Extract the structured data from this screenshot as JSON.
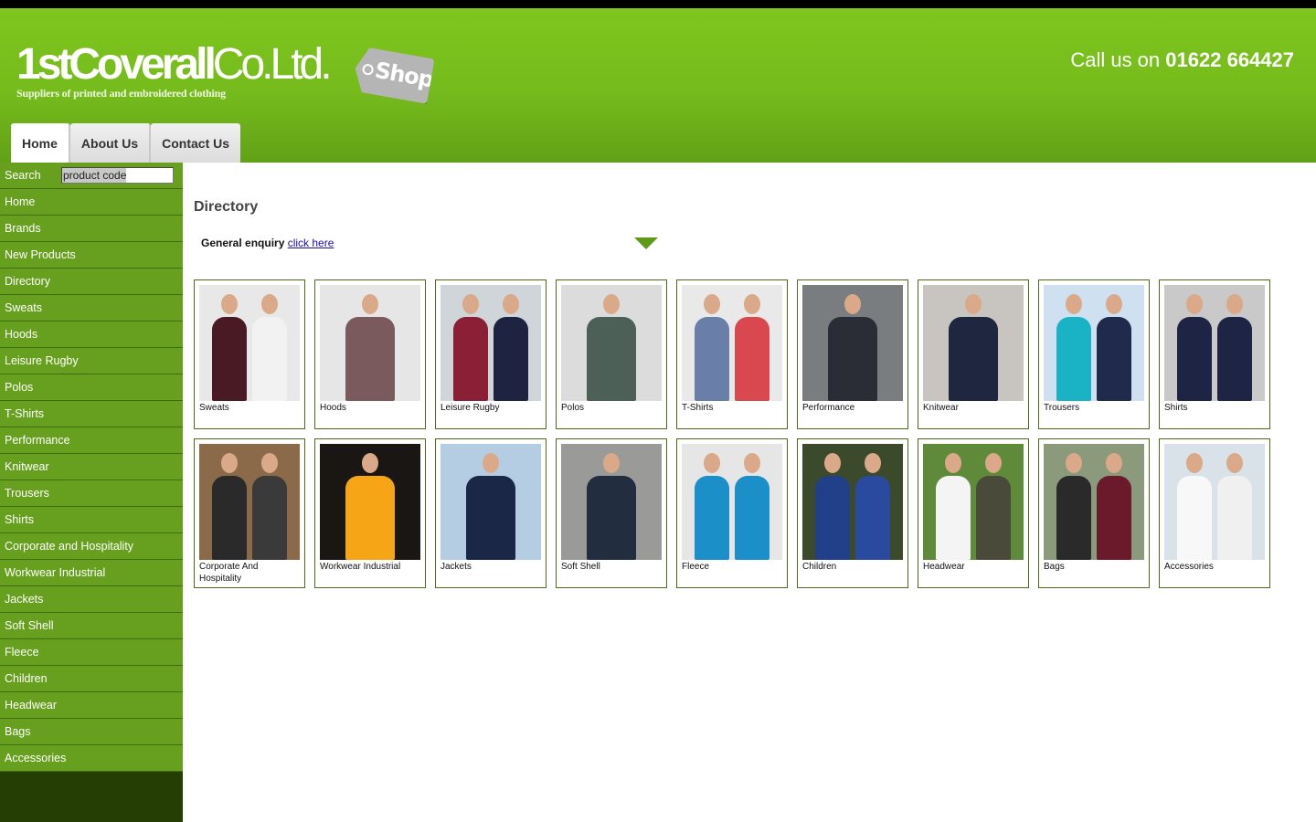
{
  "header": {
    "logo_bold": "1stCoverall",
    "logo_light": "Co.Ltd.",
    "logo_tag": "Shop",
    "tagline": "Suppliers of printed and embroidered clothing",
    "call_prefix": "Call us on",
    "phone": "01622 664427"
  },
  "tabs": [
    {
      "label": "Home",
      "active": true
    },
    {
      "label": "About Us",
      "active": false
    },
    {
      "label": "Contact Us",
      "active": false
    }
  ],
  "sidebar": {
    "search_label": "Search",
    "search_value": "product code",
    "items": [
      "Home",
      "Brands",
      "New Products",
      "Directory",
      "Sweats",
      "Hoods",
      "Leisure Rugby",
      "Polos",
      "T-Shirts",
      "Performance",
      "Knitwear",
      "Trousers",
      "Shirts",
      "Corporate and Hospitality",
      "Workwear Industrial",
      "Jackets",
      "Soft Shell",
      "Fleece",
      "Children",
      "Headwear",
      "Bags",
      "Accessories"
    ]
  },
  "main": {
    "title": "Directory",
    "enquiry_label": "General enquiry",
    "enquiry_link": "click here",
    "categories": [
      {
        "label": "Sweats",
        "bg": "#e8e8e8",
        "c1": "#4a1a24",
        "c2": "#f2f2f2"
      },
      {
        "label": "Hoods",
        "bg": "#e6e6e6",
        "c1": "#7a5a5c",
        "c2": ""
      },
      {
        "label": "Leisure Rugby",
        "bg": "#cfd5d8",
        "c1": "#8a1f35",
        "c2": "#1d2340"
      },
      {
        "label": "Polos",
        "bg": "#dcdcdc",
        "c1": "#4d6057",
        "c2": ""
      },
      {
        "label": "T-Shirts",
        "bg": "#e9e9ea",
        "c1": "#6a7fa8",
        "c2": "#d8484e"
      },
      {
        "label": "Performance",
        "bg": "#7a7d80",
        "c1": "#2a2d35",
        "c2": ""
      },
      {
        "label": "Knitwear",
        "bg": "#c8c5c0",
        "c1": "#1f2740",
        "c2": ""
      },
      {
        "label": "Trousers",
        "bg": "#cfe0f0",
        "c1": "#1ab3c6",
        "c2": "#1f2a4d"
      },
      {
        "label": "Shirts",
        "bg": "#c9c9c9",
        "c1": "#1d2444",
        "c2": "#1d2444"
      },
      {
        "label": "Corporate And Hospitality",
        "bg": "#8a6a48",
        "c1": "#2a2a2a",
        "c2": "#3a3a3a"
      },
      {
        "label": "Workwear Industrial",
        "bg": "#1a1614",
        "c1": "#f5a516",
        "c2": ""
      },
      {
        "label": "Jackets",
        "bg": "#b4cde2",
        "c1": "#1b2746",
        "c2": ""
      },
      {
        "label": "Soft Shell",
        "bg": "#9a9a98",
        "c1": "#232d40",
        "c2": ""
      },
      {
        "label": "Fleece",
        "bg": "#e6e6e6",
        "c1": "#1a8fc8",
        "c2": "#1a8fc8"
      },
      {
        "label": "Children",
        "bg": "#3a4a2a",
        "c1": "#22408a",
        "c2": "#2a4aa0"
      },
      {
        "label": "Headwear",
        "bg": "#5f8a3a",
        "c1": "#f4f4f4",
        "c2": "#4a4a3a"
      },
      {
        "label": "Bags",
        "bg": "#8a9a7a",
        "c1": "#2a2a2a",
        "c2": "#6a1a2a"
      },
      {
        "label": "Accessories",
        "bg": "#d8e2e8",
        "c1": "#f8f8f8",
        "c2": "#f0f0f0"
      }
    ]
  }
}
